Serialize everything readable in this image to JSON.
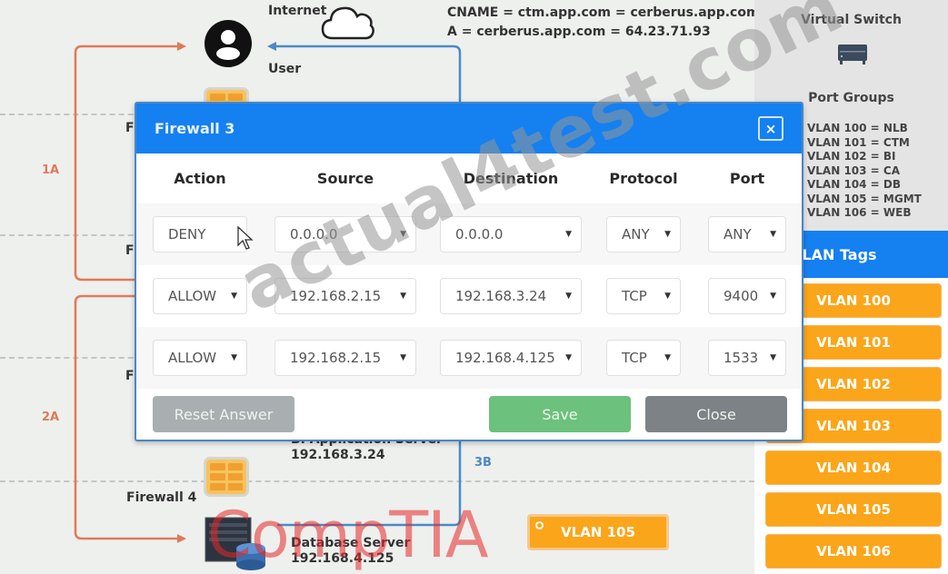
{
  "diagram": {
    "internet_label": "Internet",
    "user_label": "User",
    "dns": {
      "cname": "CNAME = ctm.app.com = cerberus.app.com",
      "a_record": "A = cerberus.app.com = 64.23.71.93"
    },
    "route_labels": {
      "r1a": "1A",
      "r2a": "2A",
      "r3b": "3B"
    },
    "firewall_partial_label": "F",
    "firewall4_label": "Firewall 4",
    "bi_server": {
      "name": "BI Application Server",
      "ip": "192.168.3.24"
    },
    "db_server": {
      "name": "Database Server",
      "ip": "192.168.4.125"
    },
    "placed_vlan": "VLAN 105",
    "colors": {
      "route_orange": "#e07a5a",
      "route_blue": "#4b8ac4"
    }
  },
  "right_panel": {
    "virtual_switch_title": "Virtual Switch",
    "port_groups_title": "Port Groups",
    "port_groups": [
      "VLAN 100 = NLB",
      "VLAN 101 = CTM",
      "VLAN 102 = BI",
      "VLAN 103 = CA",
      "VLAN 104 = DB",
      "VLAN 105 = MGMT",
      "VLAN 106 = WEB"
    ],
    "vlan_tags_title": "VLAN Tags",
    "vlan_tags": [
      "VLAN 100",
      "VLAN 101",
      "VLAN 102",
      "VLAN 103",
      "VLAN 104",
      "VLAN 105",
      "VLAN 106"
    ]
  },
  "modal": {
    "title": "Firewall 3",
    "close_icon": "×",
    "columns": [
      "Action",
      "Source",
      "Destination",
      "Protocol",
      "Port"
    ],
    "rules": [
      {
        "action": "DENY",
        "source": "0.0.0.0",
        "destination": "0.0.0.0",
        "protocol": "ANY",
        "port": "ANY"
      },
      {
        "action": "ALLOW",
        "source": "192.168.2.15",
        "destination": "192.168.3.24",
        "protocol": "TCP",
        "port": "9400"
      },
      {
        "action": "ALLOW",
        "source": "192.168.2.15",
        "destination": "192.168.4.125",
        "protocol": "TCP",
        "port": "1533"
      }
    ],
    "buttons": {
      "reset": "Reset Answer",
      "save": "Save",
      "close": "Close"
    },
    "colors": {
      "header": "#1580f0",
      "save": "#6cc17c",
      "close": "#7c8285",
      "reset": "#a9aeb1"
    }
  },
  "overlays": {
    "watermark": "actual4test.com",
    "brand_mark": "CompTIA"
  }
}
